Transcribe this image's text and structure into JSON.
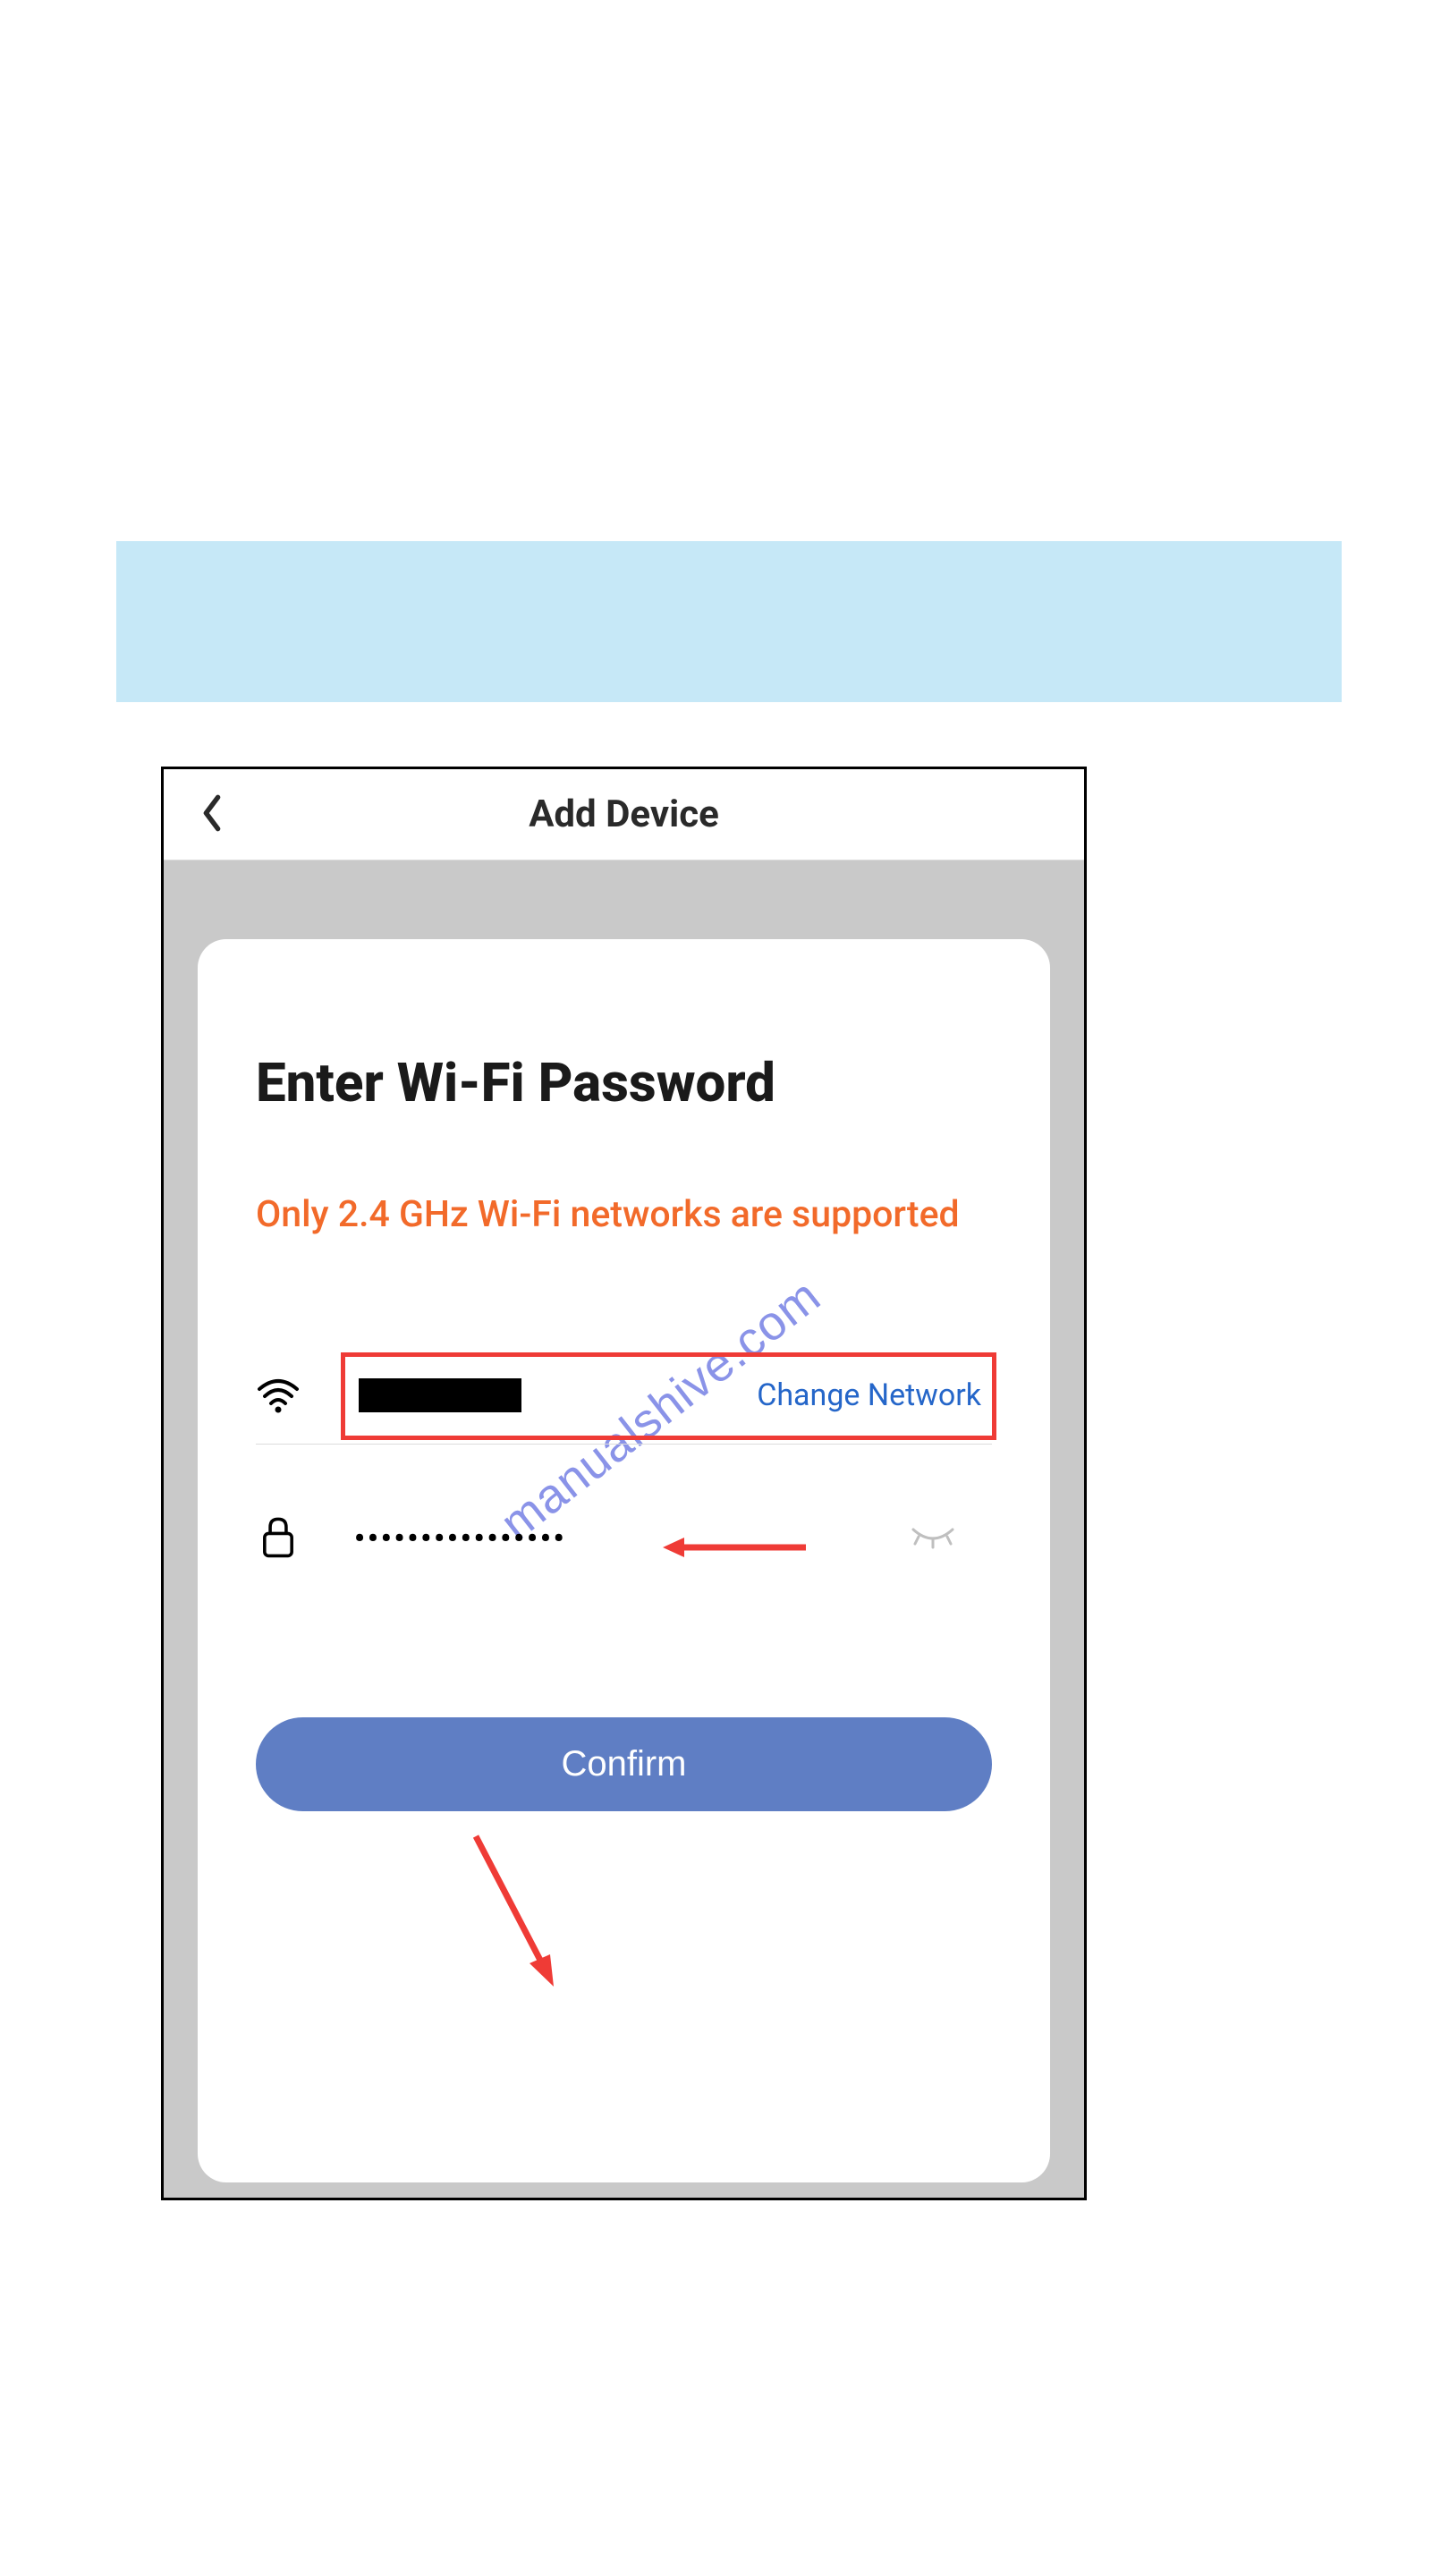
{
  "banner": {},
  "header": {
    "title": "Add Device"
  },
  "card": {
    "heading": "Enter Wi-Fi Password",
    "warning": "Only 2.4 GHz Wi-Fi networks are supported",
    "change_network_label": "Change Network",
    "password_dots": "••••••••••••••••",
    "confirm_label": "Confirm"
  },
  "watermark": "manualshive.com"
}
